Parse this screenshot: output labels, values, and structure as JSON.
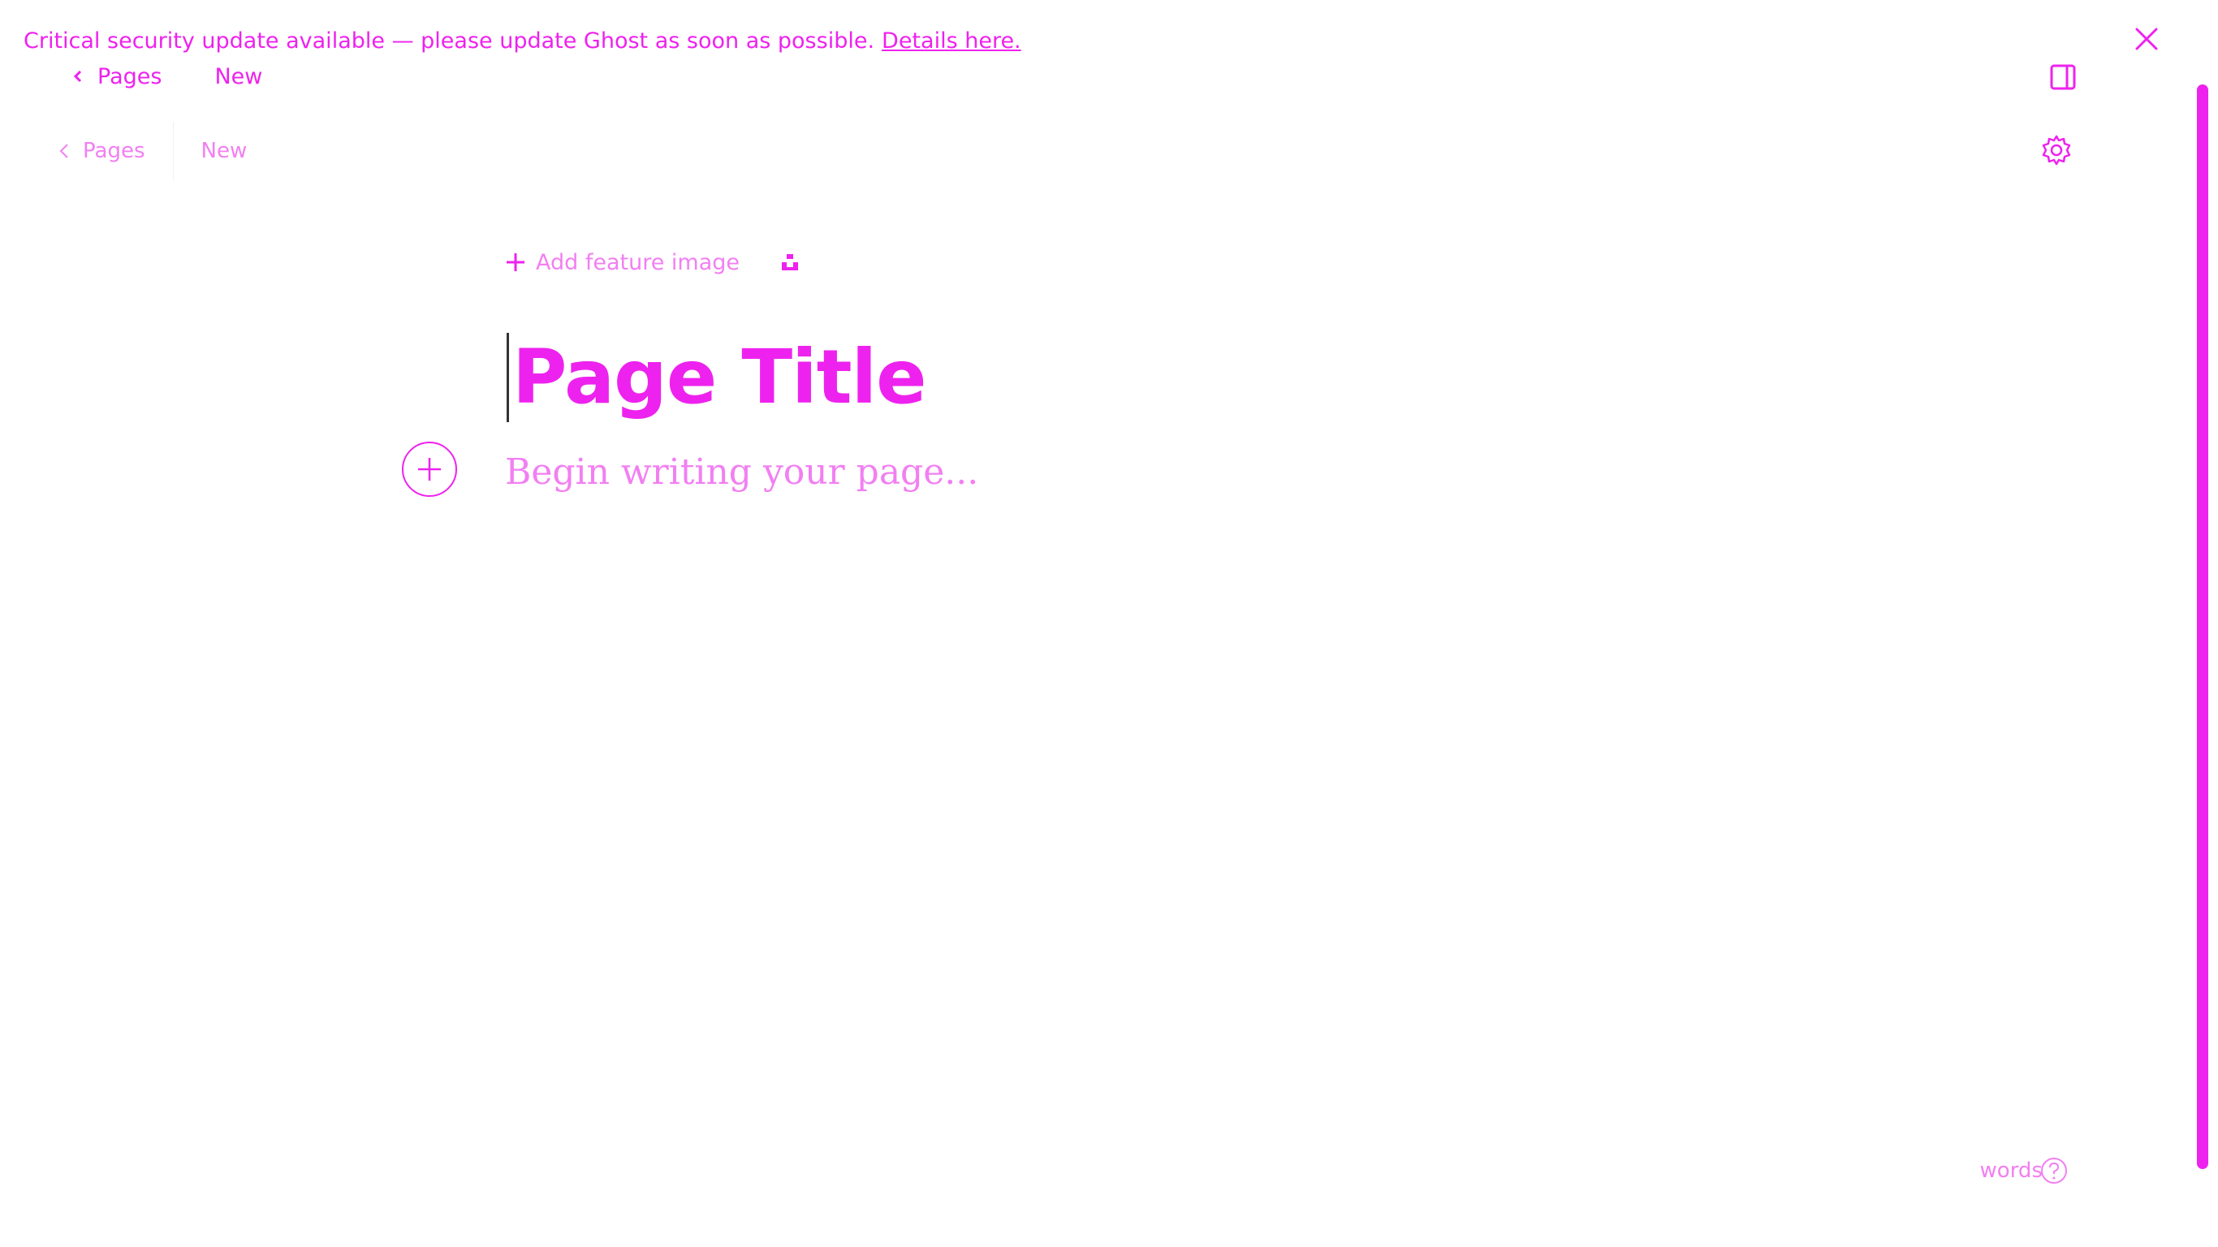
{
  "banner": {
    "message": "Critical security update available — please update Ghost as soon as possible.",
    "link_label": "Details here."
  },
  "breadcrumb_top": {
    "back_label": "Pages",
    "status": "New"
  },
  "breadcrumb_editor": {
    "back_label": "Pages",
    "status": "New"
  },
  "editor": {
    "feature_image_label": "Add feature image",
    "title": "Page Title",
    "body_placeholder": "Begin writing your page..."
  },
  "footer": {
    "word_count_label": "words"
  },
  "colors": {
    "accent": "#ee22ee",
    "accent_light": "#f27ff2"
  },
  "icons": {
    "banner_close": "close-icon",
    "back": "chevron-left-icon",
    "sidebar": "sidebar-toggle-icon",
    "settings": "gear-icon",
    "add": "plus-icon",
    "snippet": "snippet-icon",
    "add_card": "plus-circle-icon",
    "help": "question-icon"
  }
}
